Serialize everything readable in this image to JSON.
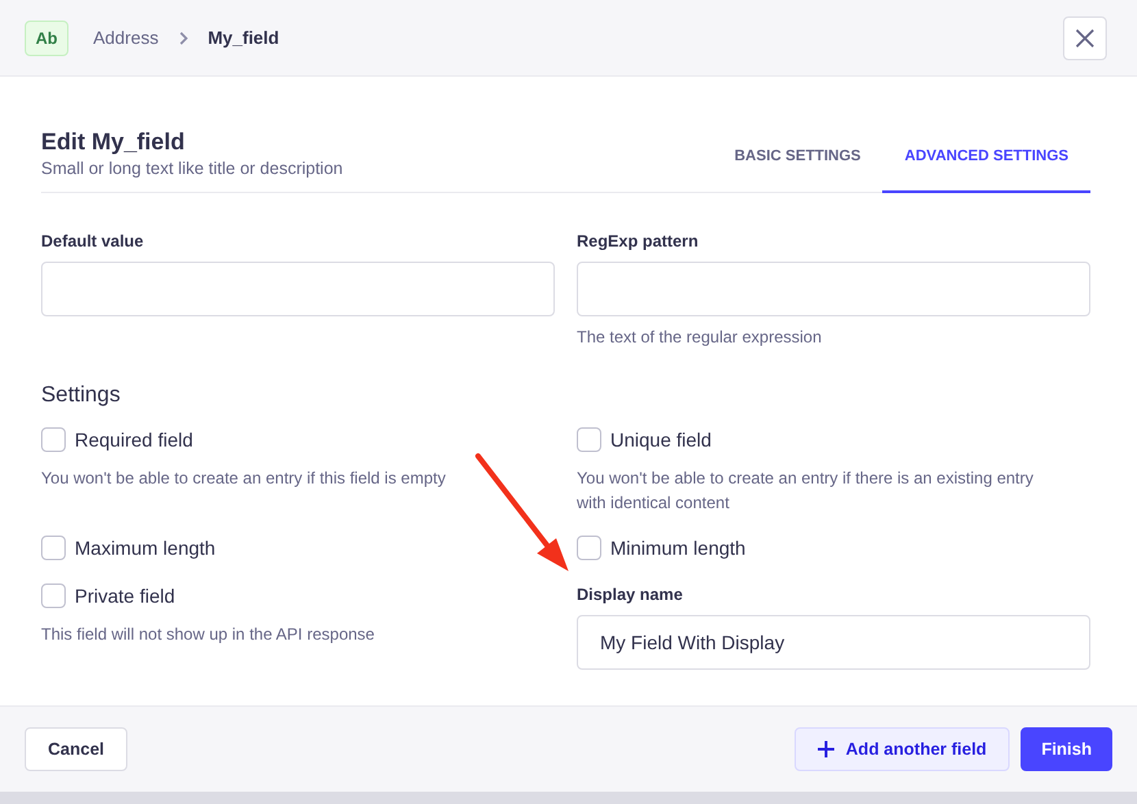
{
  "header": {
    "badge": "Ab",
    "breadcrumbs": [
      {
        "label": "Address",
        "current": false
      },
      {
        "label": "My_field",
        "current": true
      }
    ]
  },
  "title": "Edit My_field",
  "subtitle": "Small or long text like title or description",
  "tabs": [
    {
      "label": "BASIC SETTINGS",
      "selected": false
    },
    {
      "label": "ADVANCED SETTINGS",
      "selected": true
    }
  ],
  "fields": [
    {
      "label": "Default value"
    },
    {
      "label": "RegExp pattern",
      "hint": "The text of the regular expression"
    }
  ],
  "settings": {
    "heading": "Settings",
    "items": [
      {
        "kind": "checkbox",
        "label": "Required field",
        "checked": false,
        "description": "You won't be able to create an entry if this field is empty"
      },
      {
        "kind": "checkbox",
        "label": "Unique field",
        "checked": false,
        "description": "You won't be able to create an entry if there is an existing entry with identical content"
      },
      {
        "kind": "checkbox",
        "label": "Maximum length",
        "checked": false
      },
      {
        "kind": "checkbox",
        "label": "Minimum length",
        "checked": false
      },
      {
        "kind": "checkbox",
        "label": "Private field",
        "checked": false,
        "description": "This field will not show up in the API response"
      },
      {
        "kind": "input",
        "label": "Display name",
        "value": "My Field With Display"
      }
    ]
  },
  "footer": {
    "cancel": "Cancel",
    "add": "Add another field",
    "finish": "Finish"
  }
}
